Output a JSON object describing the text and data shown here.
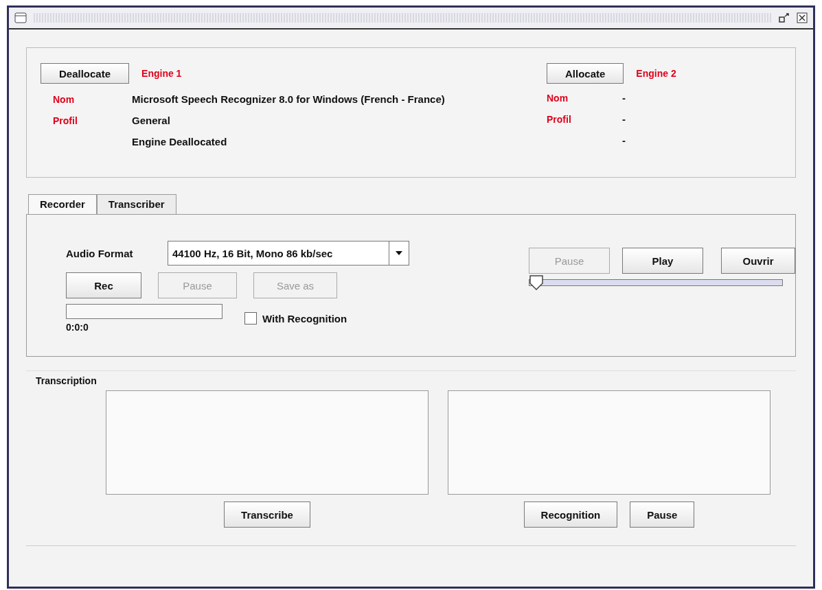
{
  "engines": [
    {
      "button": {
        "label": "Deallocate",
        "disabled": false
      },
      "title": "Engine 1",
      "name_label": "Nom",
      "name": "Microsoft Speech Recognizer 8.0 for Windows (French - France)",
      "profile_label": "Profil",
      "profile": "General",
      "status": "Engine Deallocated"
    },
    {
      "button": {
        "label": "Allocate",
        "disabled": false
      },
      "title": "Engine 2",
      "name_label": "Nom",
      "name": "-",
      "profile_label": "Profil",
      "profile": "-",
      "status": "-"
    }
  ],
  "tabs": [
    {
      "label": "Recorder",
      "selected": true
    },
    {
      "label": "Transcriber",
      "selected": false
    }
  ],
  "recorder": {
    "format_label": "Audio Format",
    "format": "44100 Hz, 16 Bit, Mono 86 kb/sec",
    "buttons": [
      {
        "label": "Rec",
        "disabled": false
      },
      {
        "label": "Pause",
        "disabled": true
      },
      {
        "label": "Save as",
        "disabled": true
      }
    ],
    "progress": {
      "level": 0
    },
    "time": "0:0:0",
    "recognition": {
      "label": "With Recognition",
      "checked": false
    }
  },
  "player": {
    "buttons": [
      {
        "label": "Pause",
        "disabled": true
      },
      {
        "label": "Play",
        "disabled": false
      },
      {
        "label": "Ouvrir",
        "disabled": false
      }
    ],
    "position": {
      "level": 0
    }
  },
  "transcription": {
    "title": "Transcription",
    "left_button": {
      "label": "Transcribe",
      "disabled": false
    },
    "right_buttons": [
      {
        "label": "Recognition",
        "disabled": false
      },
      {
        "label": "Pause",
        "disabled": false
      }
    ]
  }
}
